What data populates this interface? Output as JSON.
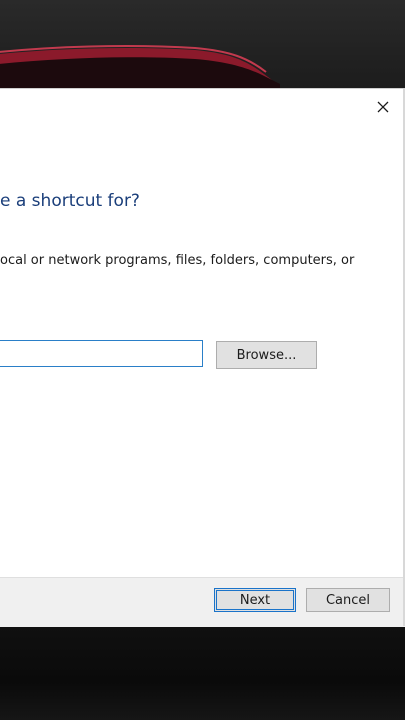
{
  "dialog": {
    "question": "e a shortcut for?",
    "description": "ocal or network programs, files, folders, computers, or",
    "location_value": "",
    "browse_label": "Browse...",
    "next_label": "Next",
    "cancel_label": "Cancel"
  },
  "icons": {
    "close": "close-icon"
  },
  "colors": {
    "accent": "#1a73c9",
    "heading": "#1a3e7a",
    "car": "#8b1a2b"
  }
}
